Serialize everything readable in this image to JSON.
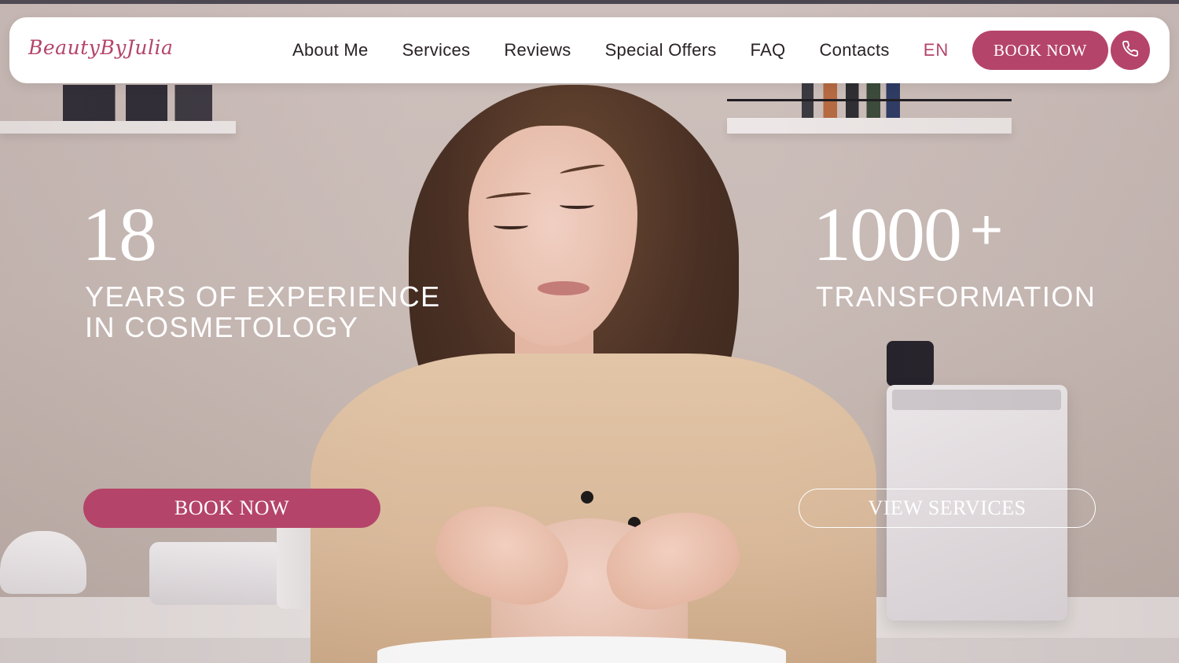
{
  "brand": {
    "logo_text": "BeautyByJulia",
    "accent_color": "#b5446a"
  },
  "nav": {
    "links": [
      {
        "label": "About Me"
      },
      {
        "label": "Services"
      },
      {
        "label": "Reviews"
      },
      {
        "label": "Special Offers"
      },
      {
        "label": "FAQ"
      },
      {
        "label": "Contacts"
      }
    ],
    "language": "EN",
    "book_label": "BOOK NOW",
    "phone_icon": "phone-icon"
  },
  "hero": {
    "stats": [
      {
        "number": "18",
        "label": "YEARS OF EXPERIENCE\nIN COSMETOLOGY"
      },
      {
        "number": "1000",
        "suffix": "+",
        "label": "TRANSFORMATION"
      }
    ],
    "book_button": "BOOK NOW",
    "services_button": "VIEW SERVICES"
  }
}
